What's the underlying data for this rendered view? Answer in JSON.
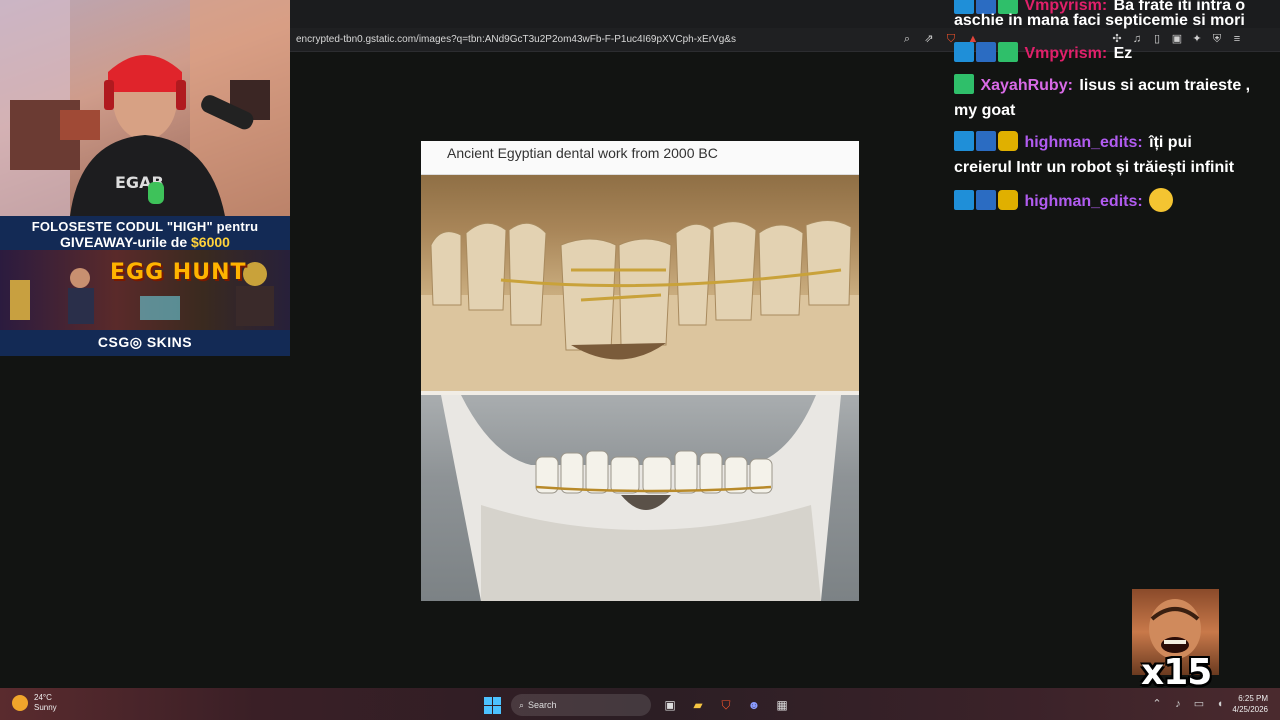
{
  "browser": {
    "url": "encrypted-tbn0.gstatic.com/images?q=tbn:ANd9GcT3u2P2om43wFb-F-P1uc4I69pXVCph-xErVg&s",
    "url_icons": [
      "zoom-icon",
      "share-icon",
      "brave-shield-icon",
      "rewards-icon"
    ],
    "toolbar_icons": [
      "extensions-icon",
      "playlist-icon",
      "sidebar-icon",
      "wallet-icon",
      "leo-icon",
      "vpn-icon",
      "menu-icon"
    ]
  },
  "content": {
    "caption": "Ancient Egyptian dental work from 2000 BC"
  },
  "stream_overlay": {
    "sponsor_line1": "FOLOSESTE CODUL \"HIGH\" pentru",
    "sponsor_line2_prefix": "GIVEAWAY-urile de ",
    "sponsor_amount": "$6000",
    "banner_title": "EGG HUNT",
    "sponsor_brand": "CSG◎ SKINS",
    "colors": {
      "amount": "#ffd23a",
      "banner_title": "#ffb400",
      "panel": "#132a55"
    }
  },
  "chat": {
    "messages": [
      {
        "user": "Vmpyrism:",
        "user_color": "#e0206a",
        "text": "Ba frate iti intra o"
      },
      {
        "user": "",
        "user_color": "#ffffff",
        "text": "aschie in mana faci septicemie si mori"
      },
      {
        "user": "Vmpyrism:",
        "user_color": "#e0206a",
        "text": "Ez"
      },
      {
        "user": "XayahRuby:",
        "user_color": "#d86ae6",
        "text": "Iisus si acum traieste ,"
      },
      {
        "user": "",
        "user_color": "#ffffff",
        "text": "my goat"
      },
      {
        "user": "highman_edits:",
        "user_color": "#b15cf0",
        "text": "îți pui"
      },
      {
        "user": "",
        "user_color": "#ffffff",
        "text": "creierul Intr un robot și trăiești infinit"
      },
      {
        "user": "highman_edits:",
        "user_color": "#b15cf0",
        "text": ""
      }
    ]
  },
  "reaction": {
    "count": "x15"
  },
  "taskbar": {
    "temp": "24°C",
    "weather": "Sunny",
    "search_label": "Search",
    "time": "6:25 PM",
    "date": "4/25/2026"
  }
}
